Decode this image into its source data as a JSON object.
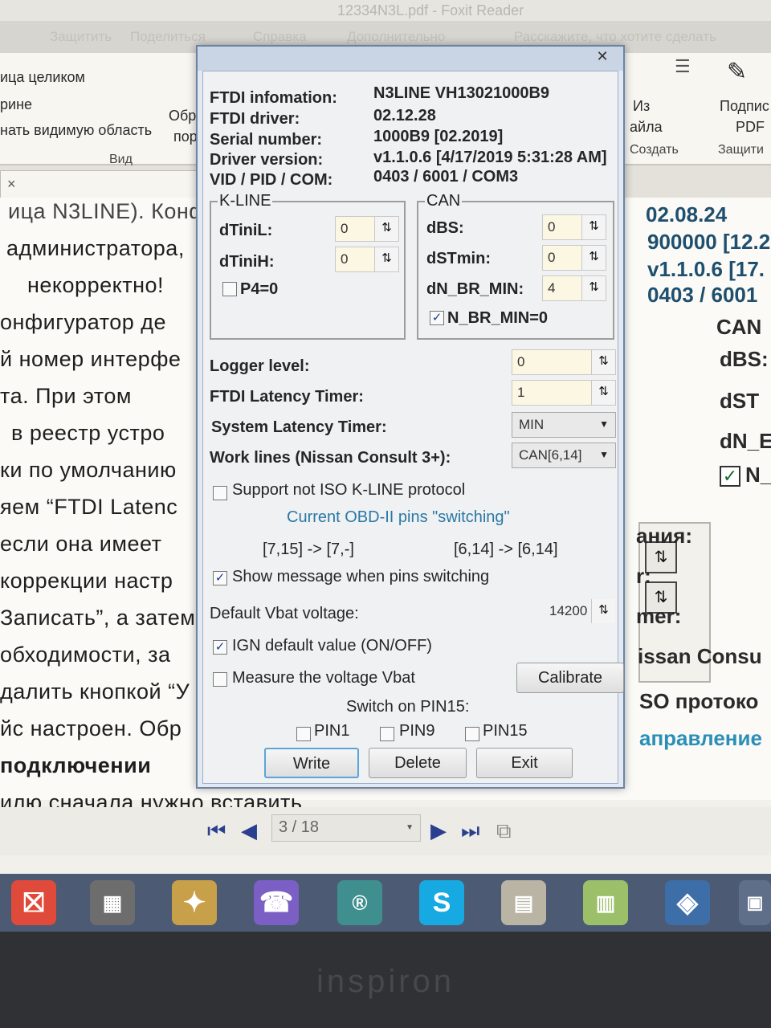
{
  "background": {
    "window_title": "12334N3L.pdf - Foxit Reader",
    "menu": [
      "Защитить",
      "Поделиться",
      "Справка",
      "Дополнительно",
      "Расскажите, что хотите сделать"
    ],
    "ribbon": {
      "items": [
        "ица целиком",
        "рине",
        "нать видимую область"
      ],
      "group_view": "Вид",
      "obr": "Обр",
      "por": "пор",
      "from_file_1": "Из",
      "from_file_2": "айла",
      "create": "Создать",
      "sign_1": "Подпис",
      "sign_2": "PDF",
      "protect": "Защити"
    },
    "tab_label": "×",
    "doc_lines": [
      "ица N3LINE). Конф",
      "администратора,",
      "некорректно!",
      "онфигуратор   де",
      "й номер интерфе",
      "та.    При    этом",
      "в   реестр  устро",
      "ки по умолчанию",
      "яем  “FTDI  Latenc",
      "если  она  имеет",
      "коррекции     настр",
      "Записать”, а затем",
      "обходимости,     за",
      "далить кнопкой “У",
      "йс настроен. Обр",
      "подключении",
      "илю    сначала    нужно    вставить"
    ],
    "right_values": [
      "02.08.24",
      "900000 [12.2",
      "v1.1.0.6 [17.",
      "0403 / 6001"
    ],
    "right_can_legend": "CAN",
    "right_can_labels": [
      "dBS:",
      "dST",
      "dN_E",
      "N_"
    ],
    "right_side_words": [
      "ания:",
      "r:",
      "mer:",
      "issan Consu",
      "SO протоко",
      "аправление"
    ],
    "page_field": "3 / 18",
    "laptop_brand": "inspiron"
  },
  "dialog": {
    "info": [
      {
        "label": "FTDI infomation:",
        "value": "N3LINE VH13021000B9"
      },
      {
        "label": "FTDI driver:",
        "value": "02.12.28"
      },
      {
        "label": "Serial number:",
        "value": "1000B9 [02.2019]"
      },
      {
        "label": "Driver version:",
        "value": "v1.1.0.6 [4/17/2019 5:31:28 AM]"
      },
      {
        "label": "VID / PID / COM:",
        "value": "0403 / 6001 / COM3"
      }
    ],
    "kline": {
      "legend": "K-LINE",
      "dTiniL_label": "dTiniL:",
      "dTiniL_value": "0",
      "dTiniH_label": "dTiniH:",
      "dTiniH_value": "0",
      "p4_label": "P4=0",
      "p4_checked": false
    },
    "can": {
      "legend": "CAN",
      "dBS_label": "dBS:",
      "dBS_value": "0",
      "dSTmin_label": "dSTmin:",
      "dSTmin_value": "0",
      "dN_BR_MIN_label": "dN_BR_MIN:",
      "dN_BR_MIN_value": "4",
      "nbr_label": "N_BR_MIN=0",
      "nbr_checked": true
    },
    "logger_level_label": "Logger level:",
    "logger_level_value": "0",
    "ftdi_latency_label": "FTDI Latency Timer:",
    "ftdi_latency_value": "1",
    "system_latency_label": "System Latency Timer:",
    "system_latency_value": "MIN",
    "work_lines_label": "Work lines (Nissan Consult 3+):",
    "work_lines_value": "CAN[6,14]",
    "support_kline_label": "Support not ISO K-LINE protocol",
    "support_kline_checked": false,
    "pins_switching_title": "Current OBD-II pins \"switching\"",
    "pins_left": "[7,15] -> [7,-]",
    "pins_right": "[6,14] -> [6,14]",
    "show_msg_label": "Show message when pins switching",
    "show_msg_checked": true,
    "vbat_label": "Default Vbat voltage:",
    "vbat_value": "14200",
    "ign_label": "IGN default value (ON/OFF)",
    "ign_checked": true,
    "measure_label": "Measure the voltage Vbat",
    "measure_checked": false,
    "calibrate_label": "Calibrate",
    "switch_pin15_label": "Switch on PIN15:",
    "pin1_label": "PIN1",
    "pin9_label": "PIN9",
    "pin15_label": "PIN15",
    "write_label": "Write",
    "delete_label": "Delete",
    "exit_label": "Exit",
    "close_glyph": "✕"
  },
  "icons": {
    "spin": "⇅",
    "check": "✓",
    "combo_arrow": "▼"
  }
}
